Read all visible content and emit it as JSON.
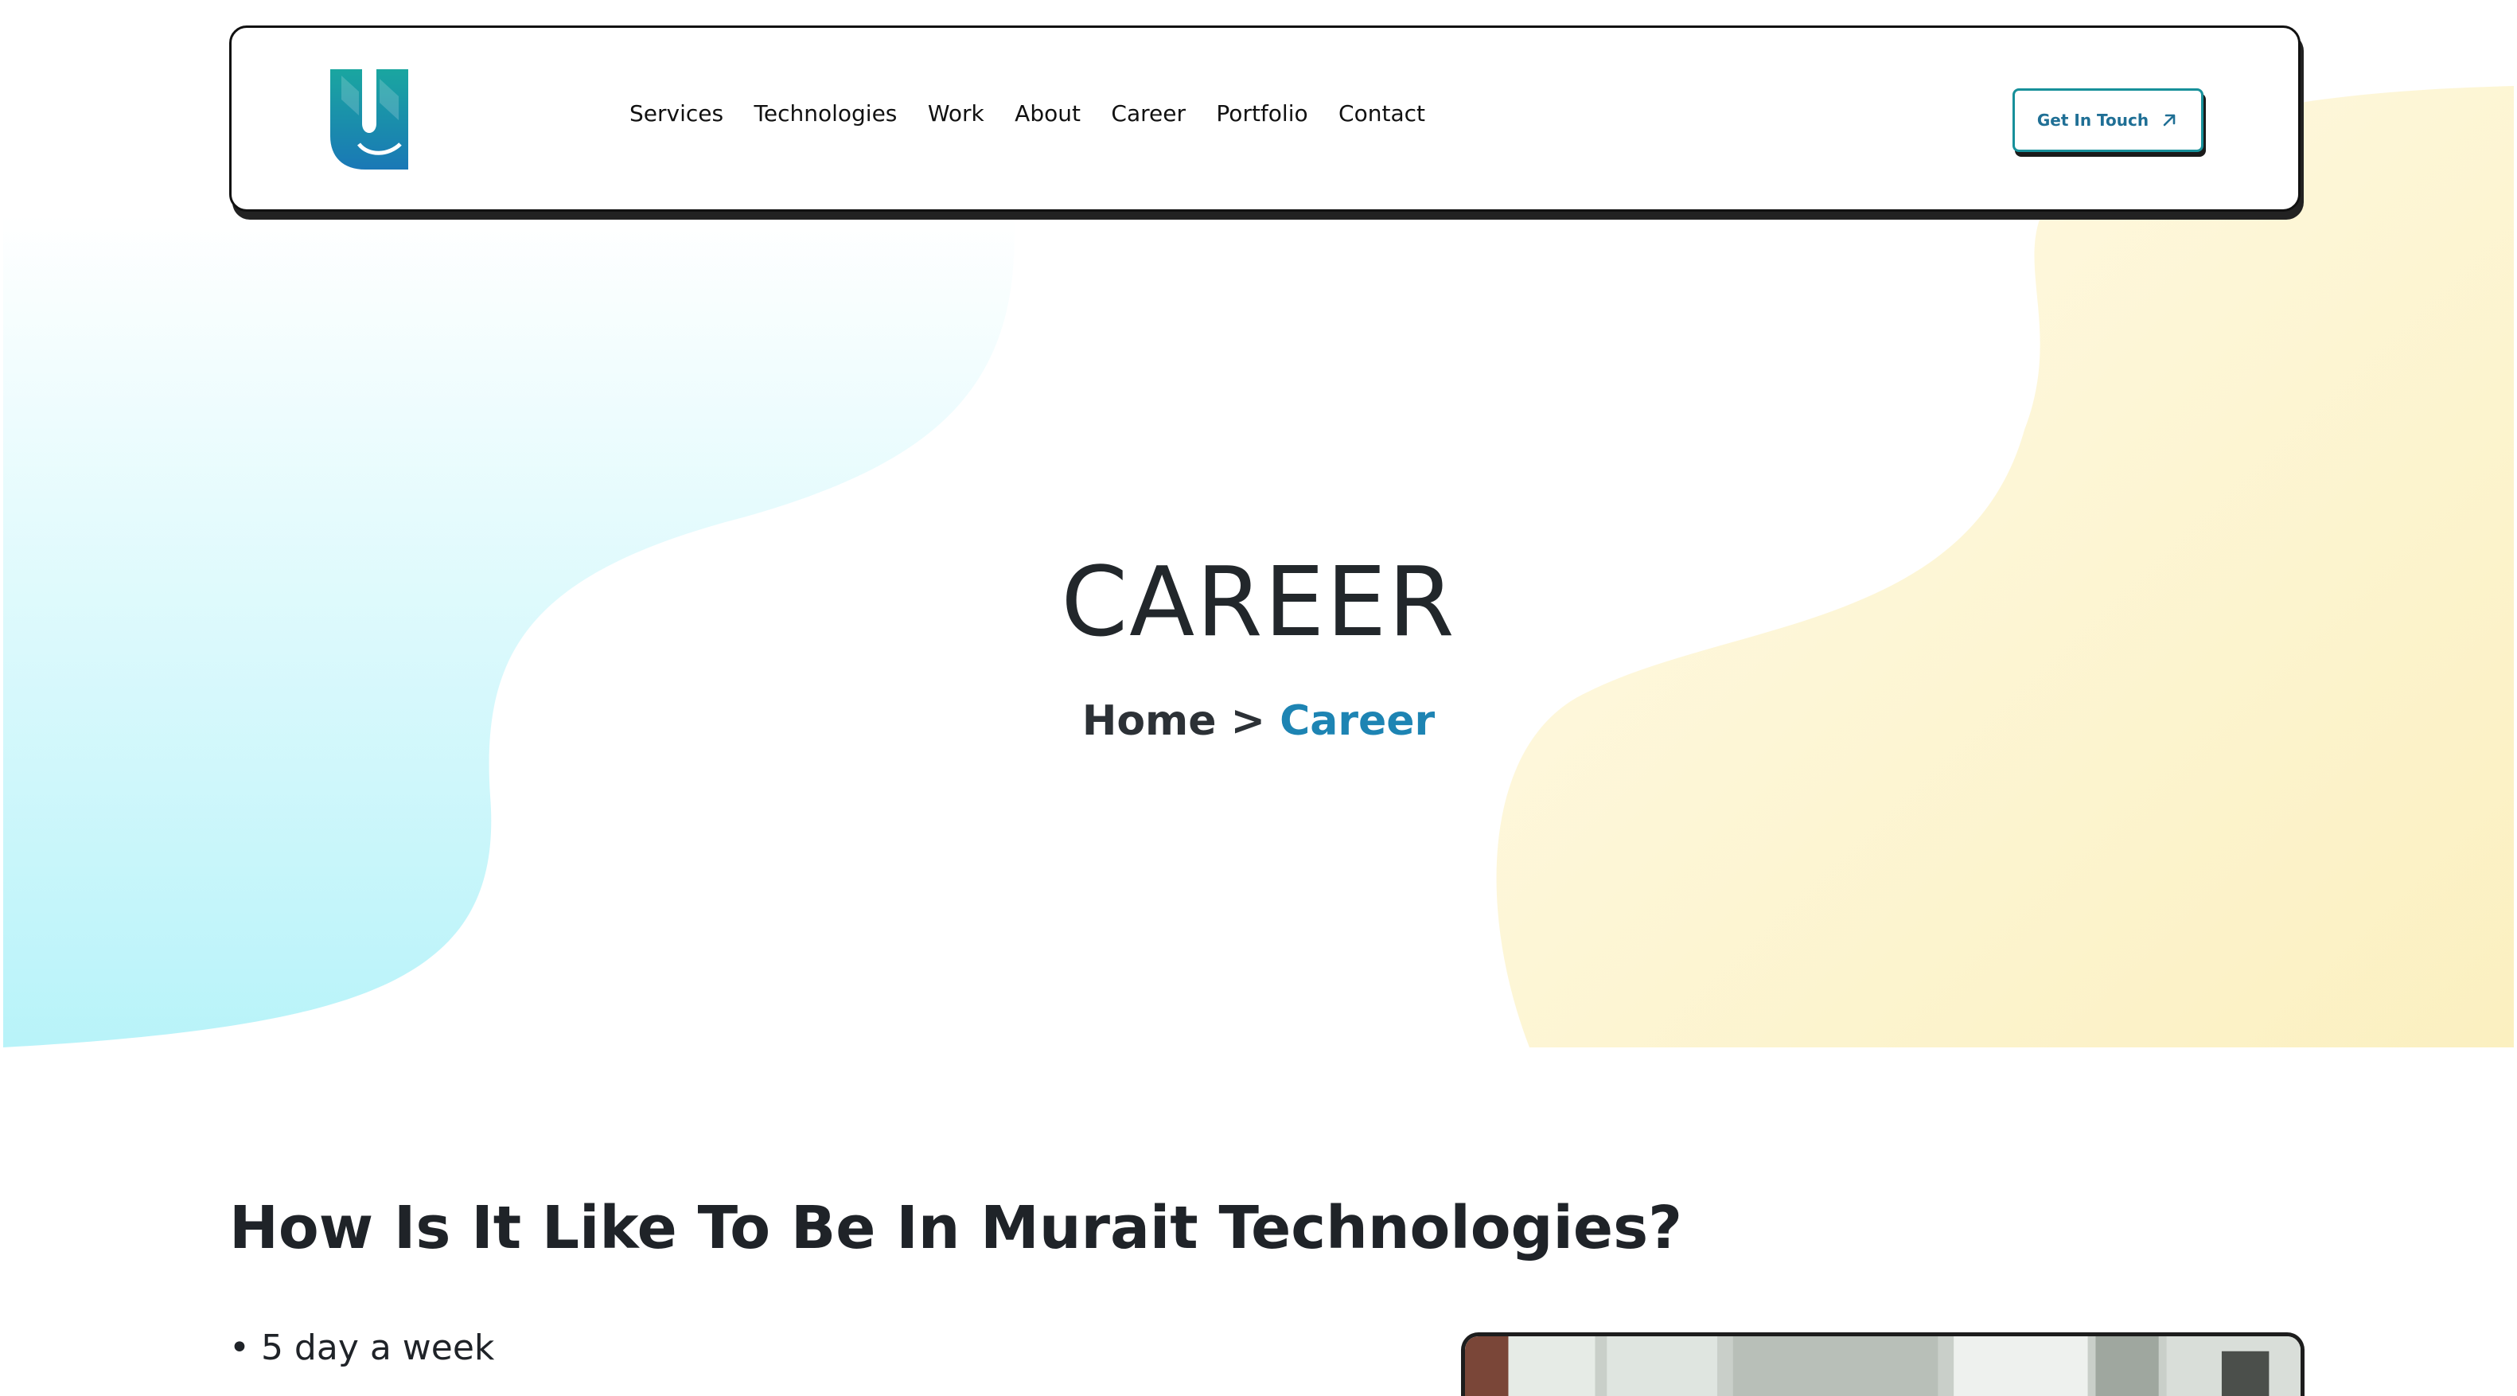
{
  "nav": {
    "logo_icon": "murait-logo-icon",
    "links": [
      {
        "label": "Services"
      },
      {
        "label": "Technologies"
      },
      {
        "label": "Work"
      },
      {
        "label": "About"
      },
      {
        "label": "Career"
      },
      {
        "label": "Portfolio"
      },
      {
        "label": "Contact"
      }
    ],
    "cta": {
      "label": "Get In Touch",
      "icon": "arrow-up-right-icon"
    }
  },
  "hero": {
    "title": "CAREER",
    "breadcrumb": {
      "home": "Home",
      "separator": ">",
      "current": "Career"
    }
  },
  "section": {
    "title": "How Is It Like To Be In Murait Technologies?",
    "bullets": [
      "• 5 day a week"
    ]
  },
  "colors": {
    "accent_blue": "#1d84b3",
    "cta_border": "#17909a",
    "blob_left": "#bff5fa",
    "blob_right": "#fbf2c4",
    "text_dark": "#22272b"
  }
}
